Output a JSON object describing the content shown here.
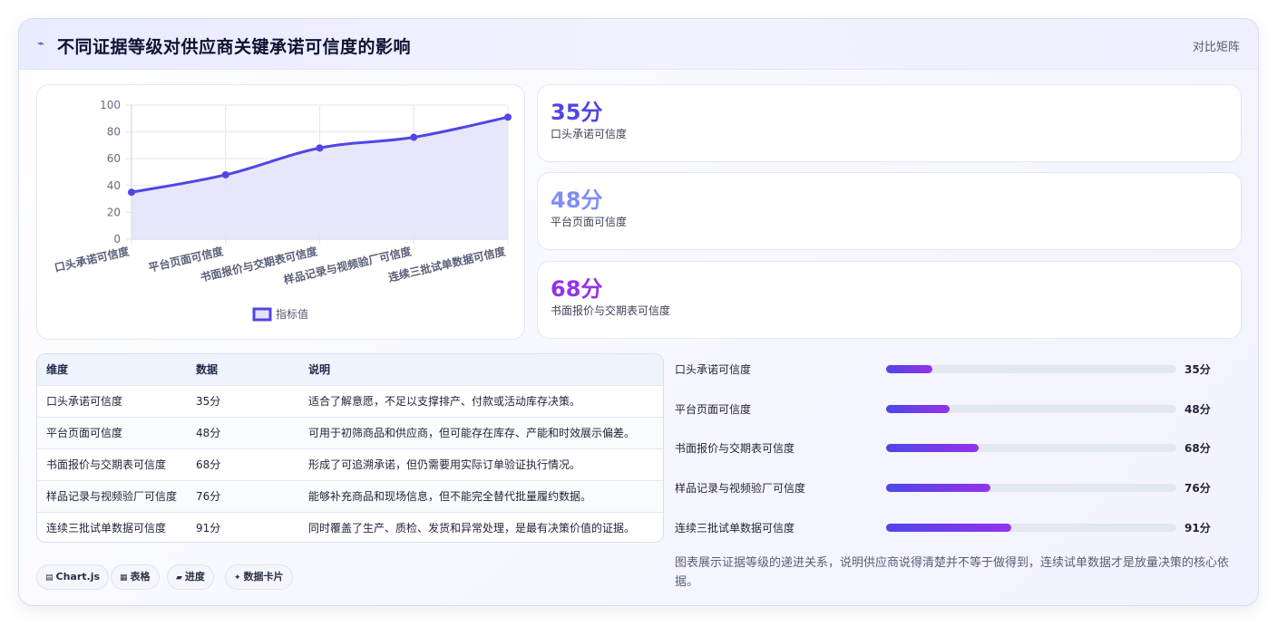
{
  "header": {
    "icon": "trend-line-icon",
    "title": "不同证据等级对供应商关键承诺可信度的影响",
    "tag": "对比矩阵"
  },
  "chart_data": {
    "type": "line",
    "categories": [
      "口头承诺可信度",
      "平台页面可信度",
      "书面报价与交期表可信度",
      "样品记录与视频验厂可信度",
      "连续三批试单数据可信度"
    ],
    "series": [
      {
        "name": "指标值",
        "values": [
          35,
          48,
          68,
          76,
          91
        ]
      }
    ],
    "ylim": [
      0,
      100
    ],
    "yticks": [
      "0",
      "20",
      "40",
      "60",
      "80",
      "100"
    ],
    "fill": true,
    "grid": true,
    "legend_position": "bottom",
    "colors": {
      "line": "#4f46e5",
      "fill": "#e4e2f8"
    }
  },
  "stat_cards": [
    {
      "value": "35分",
      "label": "口头承诺可信度",
      "color": "#4f46e5"
    },
    {
      "value": "48分",
      "label": "平台页面可信度",
      "color": "#818cf8"
    },
    {
      "value": "68分",
      "label": "书面报价与交期表可信度",
      "color": "#9333ea"
    }
  ],
  "table": {
    "headers": [
      "维度",
      "数据",
      "说明"
    ],
    "rows": [
      [
        "口头承诺可信度",
        "35分",
        "适合了解意愿，不足以支撑排产、付款或活动库存决策。"
      ],
      [
        "平台页面可信度",
        "48分",
        "可用于初筛商品和供应商，但可能存在库存、产能和时效展示偏差。"
      ],
      [
        "书面报价与交期表可信度",
        "68分",
        "形成了可追溯承诺，但仍需要用实际订单验证执行情况。"
      ],
      [
        "样品记录与视频验厂可信度",
        "76分",
        "能够补充商品和现场信息，但不能完全替代批量履约数据。"
      ],
      [
        "连续三批试单数据可信度",
        "91分",
        "同时覆盖了生产、质检、发货和异常处理，是最有决策价值的证据。"
      ]
    ]
  },
  "progress": [
    {
      "label": "口头承诺可信度",
      "value": "35分",
      "level": 0.16
    },
    {
      "label": "平台页面可信度",
      "value": "48分",
      "level": 0.22
    },
    {
      "label": "书面报价与交期表可信度",
      "value": "68分",
      "level": 0.32
    },
    {
      "label": "样品记录与视频验厂可信度",
      "value": "76分",
      "level": 0.36
    },
    {
      "label": "连续三批试单数据可信度",
      "value": "91分",
      "level": 0.43
    }
  ],
  "note": "图表展示证据等级的递进关系，说明供应商说得清楚并不等于做得到，连续试单数据才是放量决策的核心依据。",
  "tags": [
    {
      "icon": "chart-icon",
      "glyph": "▤",
      "label": "Chart.js"
    },
    {
      "icon": "table-icon",
      "glyph": "▦",
      "label": "表格"
    },
    {
      "icon": "progress-icon",
      "glyph": "▰",
      "label": "进度"
    },
    {
      "icon": "card-icon",
      "glyph": "✦",
      "label": "数据卡片"
    }
  ]
}
